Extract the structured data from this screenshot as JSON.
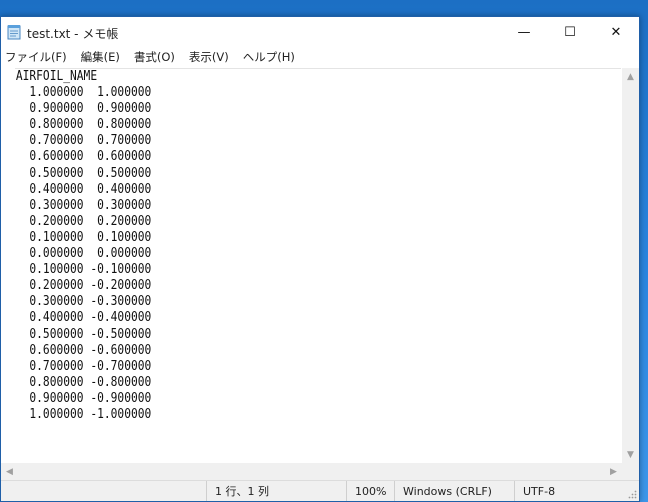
{
  "window": {
    "title": "test.txt - メモ帳",
    "controls": {
      "minimize": "—",
      "maximize": "☐",
      "close": "✕"
    }
  },
  "menu": {
    "items": [
      {
        "label": "ファイル(F)"
      },
      {
        "label": "編集(E)"
      },
      {
        "label": "書式(O)"
      },
      {
        "label": "表示(V)"
      },
      {
        "label": "ヘルプ(H)"
      }
    ]
  },
  "editor": {
    "content": "AIRFOIL_NAME\n  1.000000  1.000000\n  0.900000  0.900000\n  0.800000  0.800000\n  0.700000  0.700000\n  0.600000  0.600000\n  0.500000  0.500000\n  0.400000  0.400000\n  0.300000  0.300000\n  0.200000  0.200000\n  0.100000  0.100000\n  0.000000  0.000000\n  0.100000 -0.100000\n  0.200000 -0.200000\n  0.300000 -0.300000\n  0.400000 -0.400000\n  0.500000 -0.500000\n  0.600000 -0.600000\n  0.700000 -0.700000\n  0.800000 -0.800000\n  0.900000 -0.900000\n  1.000000 -1.000000"
  },
  "statusbar": {
    "position": "1 行、1 列",
    "zoom": "100%",
    "line_ending": "Windows (CRLF)",
    "encoding": "UTF-8"
  },
  "colors": {
    "desktop": "#1e74c8",
    "window_border": "#1f5fa8",
    "statusbar_bg": "#f0f0f0"
  },
  "icons": {
    "app": "notepad-icon",
    "scroll_up": "chevron-up-icon",
    "scroll_down": "chevron-down-icon",
    "scroll_left": "chevron-left-icon",
    "scroll_right": "chevron-right-icon"
  }
}
